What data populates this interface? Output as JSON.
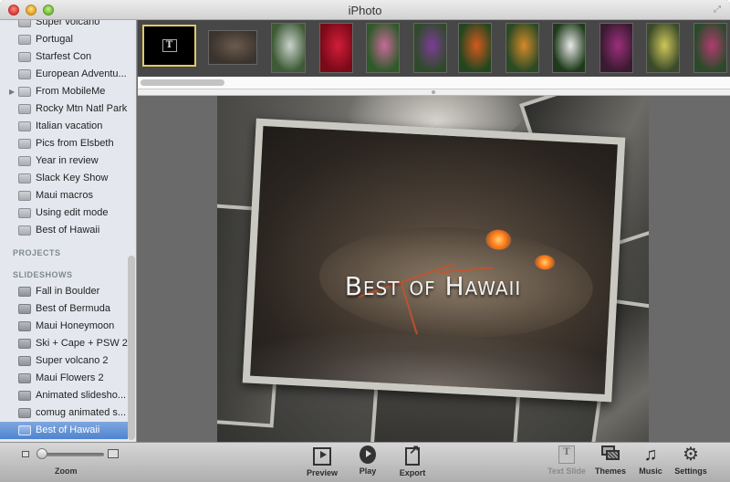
{
  "window": {
    "title": "iPhoto"
  },
  "sidebar": {
    "albums": [
      {
        "label": "Super volcano",
        "icon": "album-icon"
      },
      {
        "label": "Portugal",
        "icon": "album-icon"
      },
      {
        "label": "Starfest Con",
        "icon": "album-icon"
      },
      {
        "label": "European Adventu...",
        "icon": "album-icon"
      },
      {
        "label": "From MobileMe",
        "icon": "folder-icon",
        "expandable": true
      },
      {
        "label": "Rocky Mtn Natl Park",
        "icon": "album-icon"
      },
      {
        "label": "Italian vacation",
        "icon": "album-icon"
      },
      {
        "label": "Pics from Elsbeth",
        "icon": "album-icon"
      },
      {
        "label": "Year in review",
        "icon": "album-icon"
      },
      {
        "label": "Slack Key Show",
        "icon": "album-icon"
      },
      {
        "label": "Maui macros",
        "icon": "album-icon"
      },
      {
        "label": "Using edit mode",
        "icon": "album-icon"
      },
      {
        "label": "Best of Hawaii",
        "icon": "album-icon"
      }
    ],
    "projects_header": "PROJECTS",
    "slideshows_header": "SLIDESHOWS",
    "slideshows": [
      {
        "label": "Fall in Boulder"
      },
      {
        "label": "Best of Bermuda"
      },
      {
        "label": "Maui Honeymoon"
      },
      {
        "label": "Ski + Cape + PSW 2"
      },
      {
        "label": "Super volcano 2"
      },
      {
        "label": "Maui Flowers 2"
      },
      {
        "label": "Animated slidesho..."
      },
      {
        "label": "comug animated s..."
      },
      {
        "label": "Best of Hawaii",
        "selected": true
      }
    ]
  },
  "strip": {
    "thumbnails": [
      {
        "name": "title-slide",
        "glyph": "T",
        "selected": true
      },
      {
        "name": "lava-crater",
        "colors": [
          "#3b332d",
          "#6b5b4d"
        ]
      },
      {
        "name": "waterfall",
        "colors": [
          "#3f5a36",
          "#c9d2cc"
        ]
      },
      {
        "name": "red-ginger",
        "colors": [
          "#7a0a18",
          "#d21d3a"
        ]
      },
      {
        "name": "pink-heliconia",
        "colors": [
          "#2f5a2a",
          "#c66a98"
        ]
      },
      {
        "name": "purple-orchid-cluster",
        "colors": [
          "#2f4a2a",
          "#7c3c95"
        ]
      },
      {
        "name": "orange-heliconia",
        "colors": [
          "#24461f",
          "#d4591f"
        ]
      },
      {
        "name": "lobster-claw",
        "colors": [
          "#2c4a24",
          "#d48a2a"
        ]
      },
      {
        "name": "white-flowers",
        "colors": [
          "#1e3a1a",
          "#e8e8e8"
        ]
      },
      {
        "name": "magenta-orchid",
        "colors": [
          "#3a1a30",
          "#9c2f7c"
        ]
      },
      {
        "name": "yellow-spider-orchid",
        "colors": [
          "#3a4a2a",
          "#cfc65a"
        ]
      },
      {
        "name": "slipper-orchid",
        "colors": [
          "#2a4a2a",
          "#b03c70"
        ]
      }
    ]
  },
  "preview": {
    "slide_title": "Best of Hawaii"
  },
  "toolbar": {
    "zoom_label": "Zoom",
    "zoom_level": 0.05,
    "buttons": [
      {
        "label": "Preview",
        "icon": "preview-icon"
      },
      {
        "label": "Play",
        "icon": "play-icon"
      },
      {
        "label": "Export",
        "icon": "export-icon"
      },
      {
        "label": "Text Slide",
        "icon": "text-slide-icon",
        "disabled": true,
        "glyph": "T"
      },
      {
        "label": "Themes",
        "icon": "themes-icon"
      },
      {
        "label": "Music",
        "icon": "music-icon",
        "glyph": "♫"
      },
      {
        "label": "Settings",
        "icon": "settings-icon",
        "glyph": "⚙"
      }
    ]
  }
}
